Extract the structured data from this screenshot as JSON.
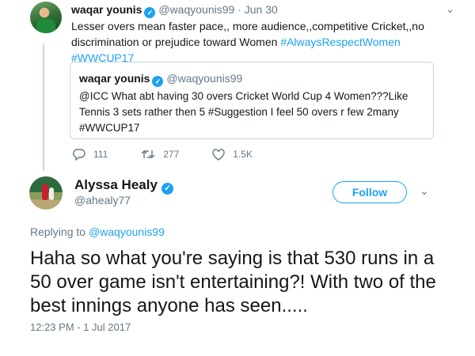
{
  "parent_tweet": {
    "name": "waqar younis",
    "handle": "@waqyounis99",
    "date": "Jun 30",
    "text_plain": "Lesser overs mean faster pace,, more audience,,competitive Cricket,,no discrimination or prejudice toward Women ",
    "hashtags": "#AlwaysRespectWomen #WWCUP17",
    "quoted": {
      "name": "waqar younis",
      "handle": "@waqyounis99",
      "text": "@ICC What abt having 30 overs Cricket World Cup 4 Women???Like Tennis 3 sets rather then 5 #Suggestion I feel 50 overs r few 2many #WWCUP17"
    },
    "actions": {
      "replies": "111",
      "retweets": "277",
      "likes": "1.5K"
    }
  },
  "main_tweet": {
    "name": "Alyssa Healy",
    "handle": "@ahealy77",
    "follow_label": "Follow",
    "replying_prefix": "Replying to",
    "replying_to": "@waqyounis99",
    "text": "Haha so what you're saying is that 530 runs in a 50 over game isn't entertaining?! With two of the best innings anyone has seen.....",
    "timestamp": "12:23 PM - 1 Jul 2017"
  },
  "colors": {
    "accent": "#1da1f2",
    "muted": "#657786",
    "border": "#ccd6dd"
  },
  "icons": {
    "verified": "verified-badge-icon",
    "chevron": "chevron-down-icon",
    "reply": "reply-icon",
    "retweet": "retweet-icon",
    "like": "heart-icon"
  }
}
